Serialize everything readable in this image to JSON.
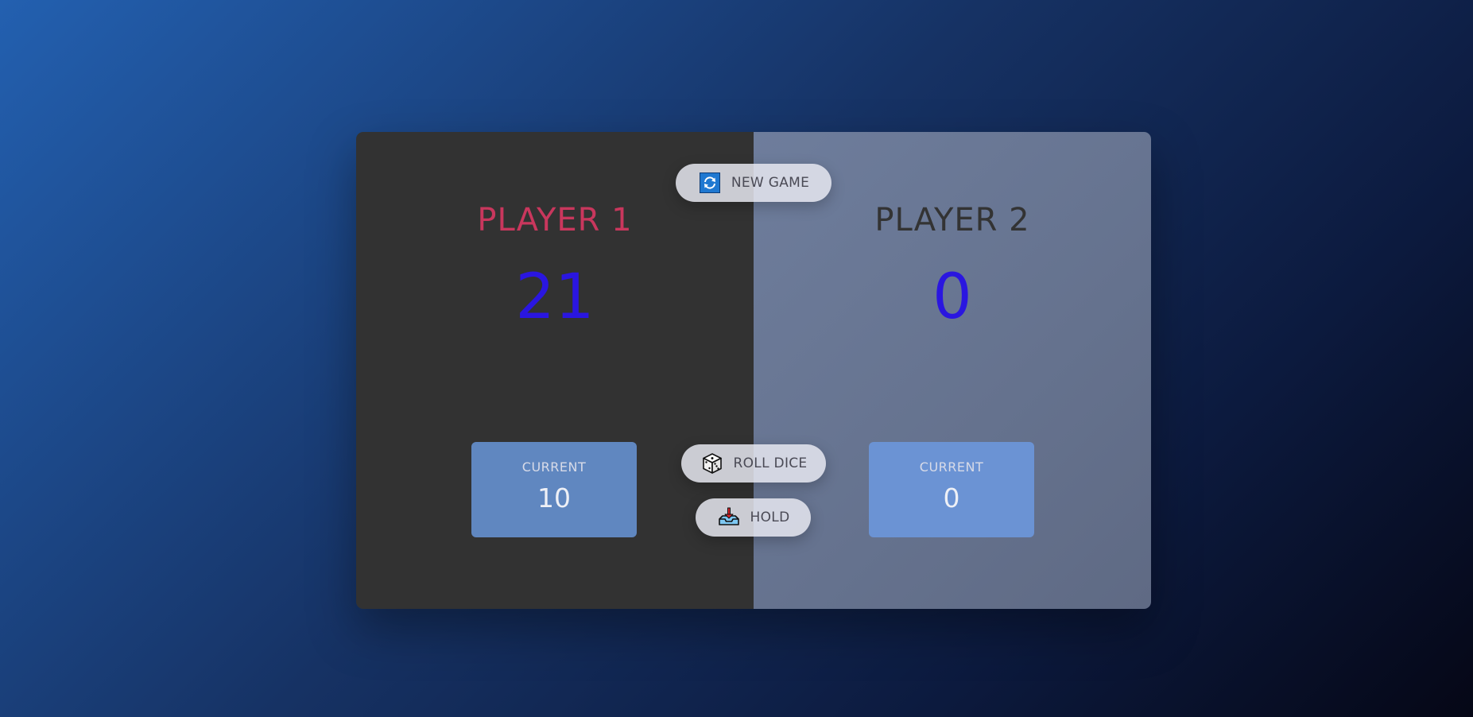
{
  "player1": {
    "name": "PLAYER 1",
    "score": "21",
    "current_label": "CURRENT",
    "current_score": "10",
    "active": true
  },
  "player2": {
    "name": "PLAYER 2",
    "score": "0",
    "current_label": "CURRENT",
    "current_score": "0",
    "active": false
  },
  "controls": {
    "new_game_label": "NEW GAME",
    "roll_dice_label": "ROLL DICE",
    "hold_label": "HOLD"
  },
  "icons": {
    "new_game": "refresh-icon",
    "roll_dice": "dice-icon",
    "hold": "hold-download-icon"
  },
  "colors": {
    "active_player_name": "#c9375d",
    "inactive_player_name": "#333333",
    "score": "#2a16e0",
    "active_panel": "#323232",
    "inactive_panel": "#6e7d9c"
  }
}
